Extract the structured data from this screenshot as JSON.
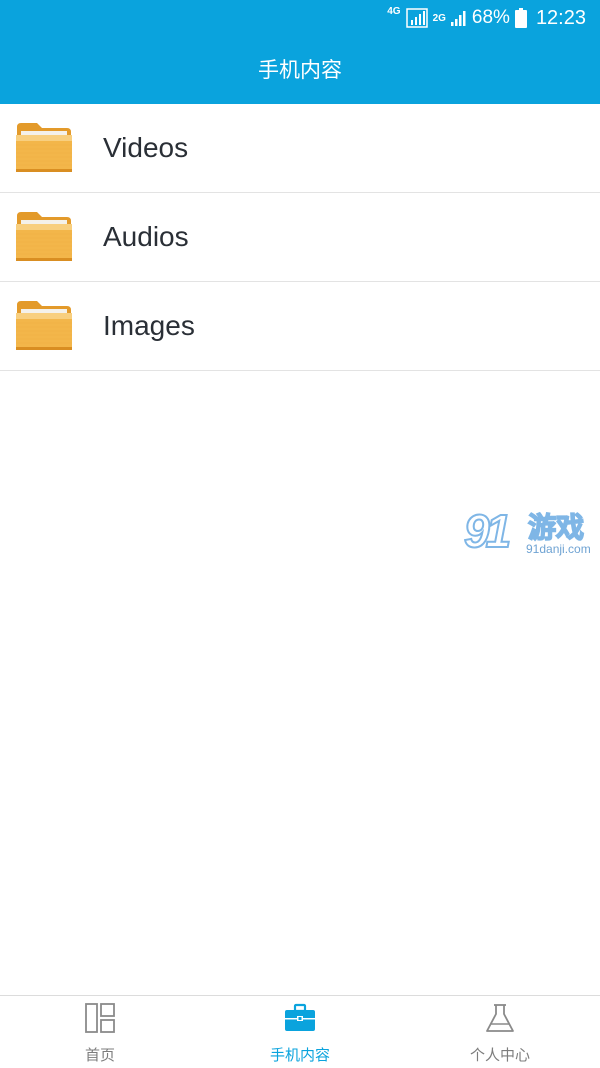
{
  "status_bar": {
    "network_tag_1": "4G",
    "network_tag_2": "2G",
    "battery": "68%",
    "time": "12:23"
  },
  "app_bar": {
    "title": "手机内容"
  },
  "folders": [
    {
      "label": "Videos",
      "icon": "folder-icon"
    },
    {
      "label": "Audios",
      "icon": "folder-icon"
    },
    {
      "label": "Images",
      "icon": "folder-icon"
    }
  ],
  "watermark": {
    "number": "91",
    "text": "游戏",
    "url": "91danji.com"
  },
  "tab_bar": {
    "tabs": [
      {
        "label": "首页",
        "icon": "home-grid-icon",
        "active": false
      },
      {
        "label": "手机内容",
        "icon": "briefcase-icon",
        "active": true
      },
      {
        "label": "个人中心",
        "icon": "flask-icon",
        "active": false
      }
    ]
  },
  "colors": {
    "accent": "#0aa3dd",
    "text": "#2a2f36",
    "tab_inactive": "#7d7d7d",
    "folder": "#f3b64a"
  }
}
